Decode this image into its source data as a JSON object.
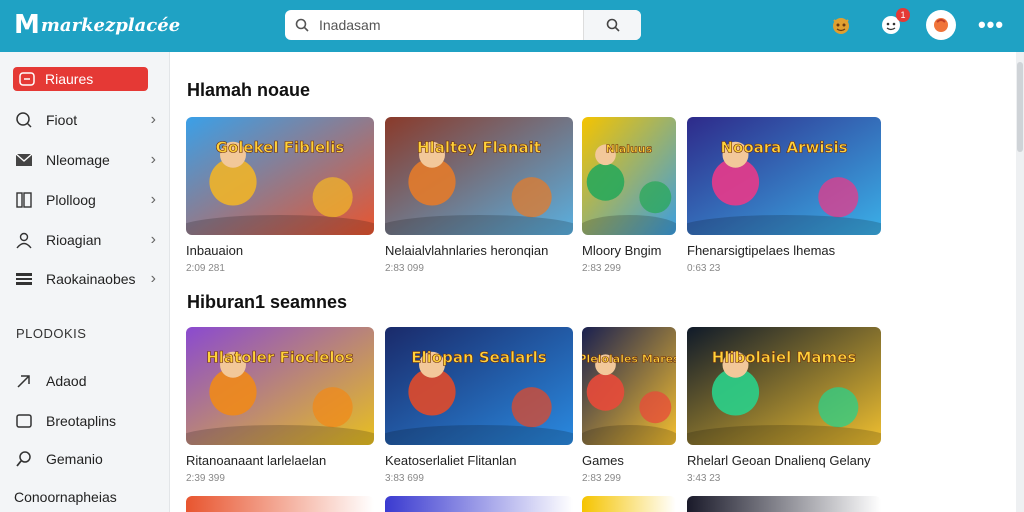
{
  "header": {
    "logo_mark": "M",
    "logo_text": "markezplacée",
    "search_placeholder": "Inadasam",
    "notification_count": "1"
  },
  "sidebar": {
    "active_item": "Riaures",
    "items": [
      {
        "label": "Fioot",
        "icon": "search-icon"
      },
      {
        "label": "Nleomage",
        "icon": "image-icon"
      },
      {
        "label": "Plolloog",
        "icon": "book-icon"
      },
      {
        "label": "Rioagian",
        "icon": "user-icon"
      },
      {
        "label": "Raokainaobes",
        "icon": "list-icon"
      }
    ],
    "heading": "PLODOKIS",
    "sub_items": [
      {
        "label": "Adaod",
        "icon": "arrow-icon"
      },
      {
        "label": "Breotaplins",
        "icon": "square-icon"
      },
      {
        "label": "Gemanio",
        "icon": "magnifier-icon"
      }
    ],
    "footer_label": "Conoornapheias"
  },
  "sections": [
    {
      "title": "Hlamah noaue",
      "cards": [
        {
          "title": "Inbauaion",
          "meta": "2:09 281",
          "thumb_text": "Golekel Fiblelis",
          "colors": [
            "#3aa0e8",
            "#f0b429",
            "#e8552f"
          ]
        },
        {
          "title": "Nelaialvlahnlaries heronqian",
          "meta": "2:83 099",
          "thumb_text": "Hlaltey Flanait",
          "colors": [
            "#8a3a2a",
            "#e37b2b",
            "#5ab0e0"
          ]
        },
        {
          "title": "Mloory Bngim",
          "meta": "2:83 299",
          "thumb_text": "Nlaluus",
          "colors": [
            "#f5c400",
            "#2aa85a",
            "#3b9ee0"
          ]
        },
        {
          "title": "Fhenarsigtipelaes lhemas",
          "meta": "0:63 23",
          "thumb_text": "Nooara Arwisis",
          "colors": [
            "#2e2a8a",
            "#e83a8a",
            "#3bb0e8"
          ]
        }
      ]
    },
    {
      "title": "Hiburan1 seamnes",
      "cards": [
        {
          "title": "Ritanoanaant larlelaelan",
          "meta": "2:39 399",
          "thumb_text": "Hlatoler Fioclelos",
          "colors": [
            "#8a4ad0",
            "#f08a1a",
            "#e8c020"
          ]
        },
        {
          "title": "Keatoserlaliet Flitanlan",
          "meta": "3:83 699",
          "thumb_text": "Eliopan Sealarls",
          "colors": [
            "#1a2a6a",
            "#e04a2a",
            "#2a8ae0"
          ]
        },
        {
          "title": "Games",
          "meta": "2:83 299",
          "thumb_text": "Plelolales Mares",
          "colors": [
            "#1a2050",
            "#e84a3a",
            "#f5c030"
          ]
        },
        {
          "title": "Rhelarl Geoan Dnalienq Gelany",
          "meta": "3:43 23",
          "thumb_text": "Hlibolaiel Mames",
          "colors": [
            "#0f1a2a",
            "#2ad08a",
            "#f0c030"
          ]
        }
      ]
    }
  ]
}
